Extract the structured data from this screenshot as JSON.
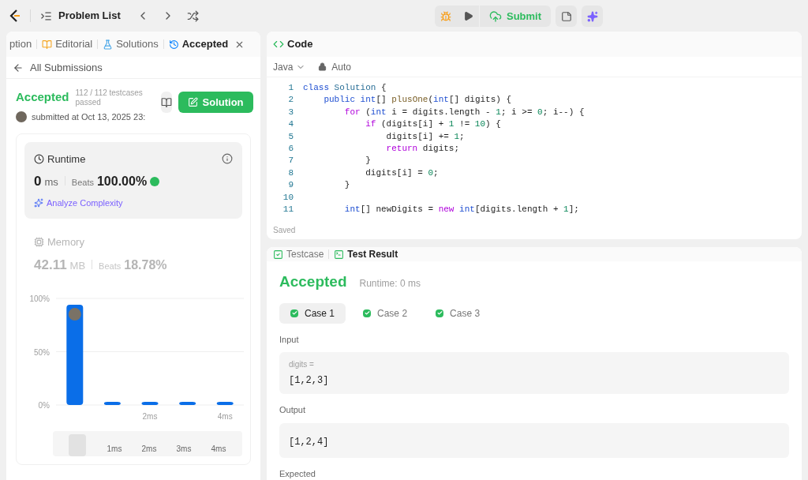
{
  "topbar": {
    "title": "Problem List",
    "submit": "Submit"
  },
  "left_tabs": [
    {
      "label": "ption",
      "selected": false,
      "closable": false
    },
    {
      "label": "Editorial",
      "selected": false,
      "closable": false
    },
    {
      "label": "Solutions",
      "selected": false,
      "closable": false
    },
    {
      "label": "Accepted",
      "selected": true,
      "closable": true
    }
  ],
  "back_link": "All Submissions",
  "submission": {
    "status": "Accepted",
    "testcases": "112 / 112 testcases passed",
    "submitted": "submitted at Oct 13, 2025 23:",
    "solution_button": "Solution"
  },
  "runtime": {
    "title": "Runtime",
    "value": "0",
    "unit": "ms",
    "beats_label": "Beats",
    "beats": "100.00%",
    "analyze": "Analyze Complexity",
    "selected": true
  },
  "memory": {
    "title": "Memory",
    "value": "42.11",
    "unit": "MB",
    "beats_label": "Beats",
    "beats": "18.78%",
    "selected": false
  },
  "chart_data": {
    "type": "bar",
    "categories": [
      null,
      null,
      "2ms",
      null,
      "4ms"
    ],
    "ylim": [
      0,
      100
    ],
    "yticks": [
      {
        "value": 0,
        "label": "0%"
      },
      {
        "value": 50,
        "label": "50%"
      },
      {
        "value": 100,
        "label": "100%"
      }
    ],
    "series": [
      {
        "color": "#0a6ee8",
        "values": [
          94,
          2,
          2,
          2,
          2
        ]
      }
    ]
  },
  "overview_labels": [
    "1ms",
    "2ms",
    "3ms",
    "4ms"
  ],
  "code_panel": {
    "title": "Code",
    "language": "Java",
    "mode": "Auto",
    "status": "Saved",
    "lines": [
      {
        "number": "1",
        "tokens": [
          {
            "kind": "kw",
            "text": "class"
          },
          {
            "kind": "type",
            "text": " Solution"
          },
          {
            "kind": "plain",
            "text": " {"
          }
        ]
      },
      {
        "number": "2",
        "tokens": [
          {
            "kind": "kw",
            "text": "    public"
          },
          {
            "kind": "kw",
            "text": " int"
          },
          {
            "kind": "plain",
            "text": "[] "
          },
          {
            "kind": "fn",
            "text": "plusOne"
          },
          {
            "kind": "plain",
            "text": "("
          },
          {
            "kind": "kw",
            "text": "int"
          },
          {
            "kind": "plain",
            "text": "[] digits) {"
          }
        ]
      },
      {
        "number": "3",
        "tokens": [
          {
            "kind": "ctl",
            "text": "        for"
          },
          {
            "kind": "plain",
            "text": " ("
          },
          {
            "kind": "kw",
            "text": "int"
          },
          {
            "kind": "plain",
            "text": " i = digits.length - "
          },
          {
            "kind": "num",
            "text": "1"
          },
          {
            "kind": "plain",
            "text": "; i >= "
          },
          {
            "kind": "num",
            "text": "0"
          },
          {
            "kind": "plain",
            "text": "; i--) {"
          }
        ]
      },
      {
        "number": "4",
        "tokens": [
          {
            "kind": "ctl",
            "text": "            if"
          },
          {
            "kind": "plain",
            "text": " (digits[i] + "
          },
          {
            "kind": "num",
            "text": "1"
          },
          {
            "kind": "plain",
            "text": " != "
          },
          {
            "kind": "num",
            "text": "10"
          },
          {
            "kind": "plain",
            "text": ") {"
          }
        ]
      },
      {
        "number": "5",
        "tokens": [
          {
            "kind": "plain",
            "text": "                digits[i] += "
          },
          {
            "kind": "num",
            "text": "1"
          },
          {
            "kind": "plain",
            "text": ";"
          }
        ]
      },
      {
        "number": "6",
        "tokens": [
          {
            "kind": "ctl",
            "text": "                return"
          },
          {
            "kind": "plain",
            "text": " digits;"
          }
        ]
      },
      {
        "number": "7",
        "tokens": [
          {
            "kind": "plain",
            "text": "            }"
          }
        ]
      },
      {
        "number": "8",
        "tokens": [
          {
            "kind": "plain",
            "text": "            digits[i] = "
          },
          {
            "kind": "num",
            "text": "0"
          },
          {
            "kind": "plain",
            "text": ";"
          }
        ]
      },
      {
        "number": "9",
        "tokens": [
          {
            "kind": "plain",
            "text": "        }"
          }
        ]
      },
      {
        "number": "10"
      },
      {
        "number": "11",
        "tokens": [
          {
            "kind": "kw",
            "text": "        int"
          },
          {
            "kind": "plain",
            "text": "[] newDigits = "
          },
          {
            "kind": "ctl",
            "text": "new"
          },
          {
            "kind": "kw",
            "text": " int"
          },
          {
            "kind": "plain",
            "text": "[digits.length + "
          },
          {
            "kind": "num",
            "text": "1"
          },
          {
            "kind": "plain",
            "text": "];"
          }
        ]
      }
    ]
  },
  "result_tabs": [
    {
      "label": "Testcase",
      "selected": false
    },
    {
      "label": "Test Result",
      "selected": true
    }
  ],
  "result": {
    "status": "Accepted",
    "runtime": "Runtime: 0 ms",
    "cases": [
      {
        "label": "Case 1",
        "selected": true
      },
      {
        "label": "Case 2",
        "selected": false
      },
      {
        "label": "Case 3",
        "selected": false
      }
    ],
    "input_label": "Input",
    "param": "digits =",
    "input_value": "[1,2,3]",
    "output_label": "Output",
    "output_value": "[1,2,4]",
    "expected_label": "Expected"
  }
}
